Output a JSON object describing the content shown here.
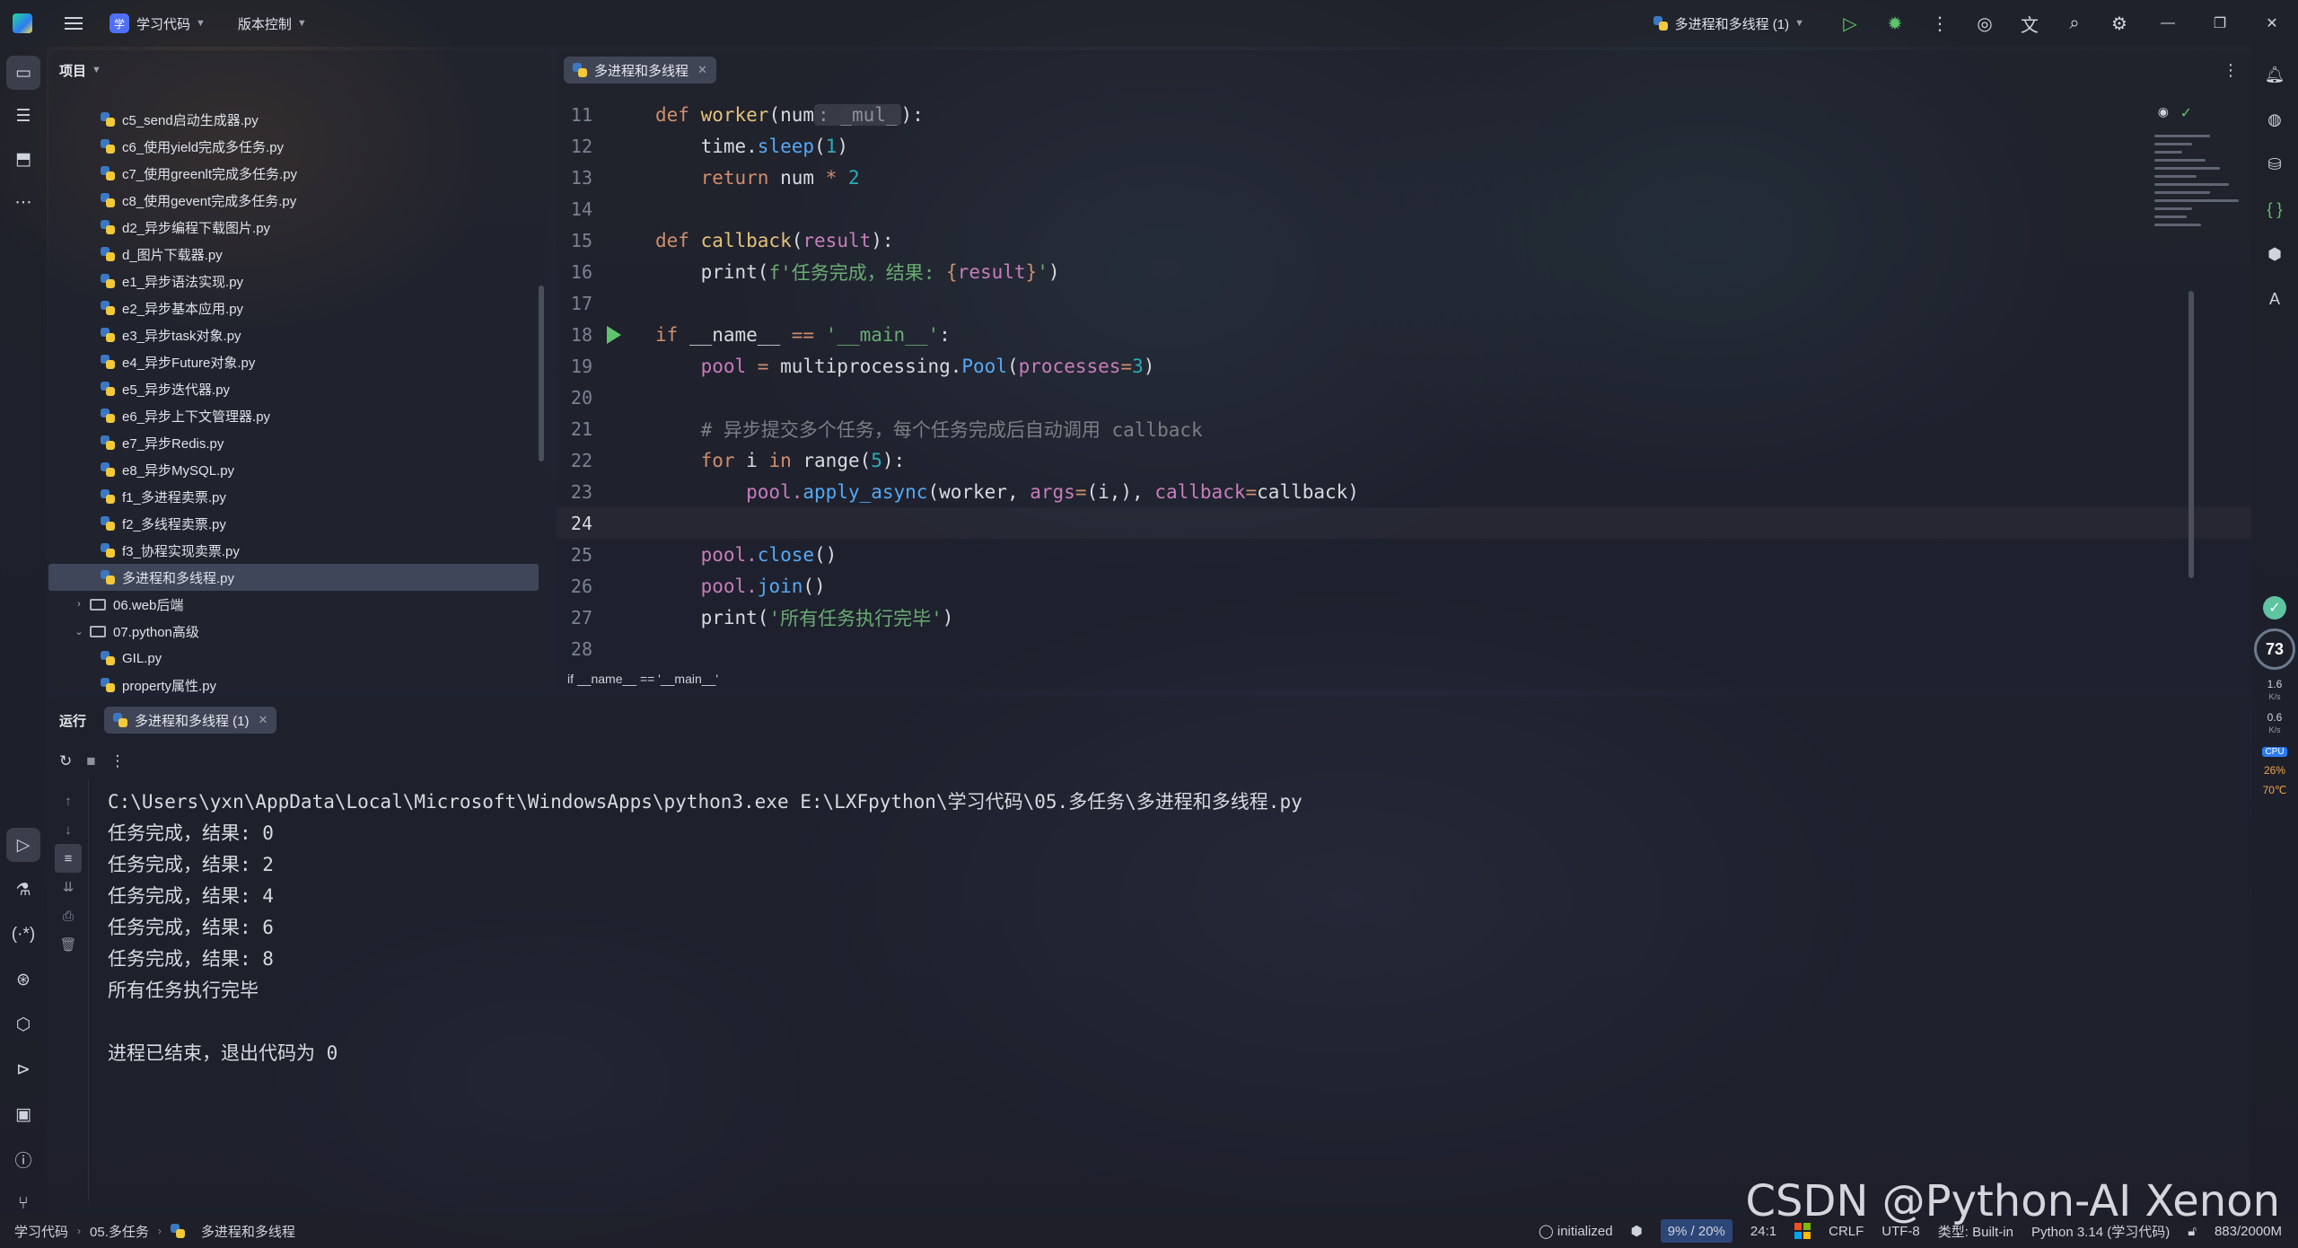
{
  "titlebar": {
    "project_badge": "学",
    "project_name": "学习代码",
    "vcs_label": "版本控制",
    "run_config": "多进程和多线程 (1)"
  },
  "project_panel": {
    "title": "项目",
    "items": [
      {
        "name": "c5_send启动生成器.py",
        "type": "file"
      },
      {
        "name": "c6_使用yield完成多任务.py",
        "type": "file"
      },
      {
        "name": "c7_使用greenlt完成多任务.py",
        "type": "file"
      },
      {
        "name": "c8_使用gevent完成多任务.py",
        "type": "file"
      },
      {
        "name": "d2_异步编程下载图片.py",
        "type": "file"
      },
      {
        "name": "d_图片下载器.py",
        "type": "file"
      },
      {
        "name": "e1_异步语法实现.py",
        "type": "file"
      },
      {
        "name": "e2_异步基本应用.py",
        "type": "file"
      },
      {
        "name": "e3_异步task对象.py",
        "type": "file"
      },
      {
        "name": "e4_异步Future对象.py",
        "type": "file"
      },
      {
        "name": "e5_异步迭代器.py",
        "type": "file"
      },
      {
        "name": "e6_异步上下文管理器.py",
        "type": "file"
      },
      {
        "name": "e7_异步Redis.py",
        "type": "file"
      },
      {
        "name": "e8_异步MySQL.py",
        "type": "file"
      },
      {
        "name": "f1_多进程卖票.py",
        "type": "file"
      },
      {
        "name": "f2_多线程卖票.py",
        "type": "file"
      },
      {
        "name": "f3_协程实现卖票.py",
        "type": "file"
      },
      {
        "name": "多进程和多线程.py",
        "type": "file",
        "selected": true
      },
      {
        "name": "06.web后端",
        "type": "folder",
        "expanded": false
      },
      {
        "name": "07.python高级",
        "type": "folder",
        "expanded": true
      },
      {
        "name": "GIL.py",
        "type": "file"
      },
      {
        "name": "property属性.py",
        "type": "file"
      }
    ]
  },
  "editor": {
    "tab_label": "多进程和多线程",
    "breadcrumb": "if __name__ == '__main__'",
    "line_numbers": [
      "11",
      "12",
      "13",
      "14",
      "15",
      "16",
      "17",
      "18",
      "19",
      "20",
      "21",
      "22",
      "23",
      "24",
      "25",
      "26",
      "27",
      "28"
    ],
    "code": {
      "l11_def": "def ",
      "l11_fn": "worker",
      "l11_open": "(",
      "l11_param": "num",
      "l11_hint": ": _mul_",
      "l11_close": "):",
      "l12_a": "    time.",
      "l12_m": "sleep",
      "l12_b": "(",
      "l12_n": "1",
      "l12_c": ")",
      "l13_kw": "    return ",
      "l13_a": "num ",
      "l13_op": "* ",
      "l13_n": "2",
      "l15_def": "def ",
      "l15_fn": "callback",
      "l15_open": "(",
      "l15_param": "result",
      "l15_close": "):",
      "l16_a": "    print(",
      "l16_s1": "f'任务完成，结果: ",
      "l16_b": "{",
      "l16_p": "result",
      "l16_c": "}",
      "l16_s2": "'",
      "l16_d": ")",
      "l18_kw": "if ",
      "l18_a": "__name__ ",
      "l18_op": "== ",
      "l18_s": "'__main__'",
      "l18_b": ":",
      "l19_p": "    pool ",
      "l19_op": "= ",
      "l19_a": "multiprocessing.",
      "l19_m": "Pool",
      "l19_b": "(",
      "l19_k": "processes",
      "l19_op2": "=",
      "l19_n": "3",
      "l19_c": ")",
      "l21_cmt": "    # 异步提交多个任务，每个任务完成后自动调用 callback",
      "l22_kw": "    for ",
      "l22_a": "i ",
      "l22_kw2": "in ",
      "l22_b": "range(",
      "l22_n": "5",
      "l22_c": "):",
      "l23_p": "        pool.",
      "l23_m": "apply_async",
      "l23_a": "(worker, ",
      "l23_k": "args",
      "l23_op": "=",
      "l23_b": "(i,), ",
      "l23_k2": "callback",
      "l23_op2": "=",
      "l23_c": "callback)",
      "l25_p": "    pool.",
      "l25_m": "close",
      "l25_a": "()",
      "l26_p": "    pool.",
      "l26_m": "join",
      "l26_a": "()",
      "l27_a": "    print(",
      "l27_s": "'所有任务执行完毕'",
      "l27_b": ")"
    }
  },
  "run_panel": {
    "title": "运行",
    "tab_label": "多进程和多线程 (1)",
    "output": [
      "C:\\Users\\yxn\\AppData\\Local\\Microsoft\\WindowsApps\\python3.exe E:\\LXFpython\\学习代码\\05.多任务\\多进程和多线程.py",
      "任务完成，结果: 0",
      "任务完成，结果: 2",
      "任务完成，结果: 4",
      "任务完成，结果: 6",
      "任务完成，结果: 8",
      "所有任务执行完毕",
      "",
      "进程已结束，退出代码为 0"
    ]
  },
  "monitor": {
    "score": "73",
    "up_speed": "1.6",
    "down_speed": "0.6",
    "speed_unit": "K/s",
    "cpu_label": "CPU",
    "cpu_usage": "26%",
    "cpu_temp": "70℃"
  },
  "statusbar": {
    "crumbs": [
      "学习代码",
      "05.多任务",
      "多进程和多线程"
    ],
    "initialized": "initialized",
    "memory": "9% / 20%",
    "position": "24:1",
    "line_sep": "CRLF",
    "encoding": "UTF-8",
    "type": "类型: Built-in",
    "interpreter": "Python 3.14 (学习代码)",
    "heap": "883/2000M"
  },
  "watermark": "CSDN @Python-AI Xenon"
}
